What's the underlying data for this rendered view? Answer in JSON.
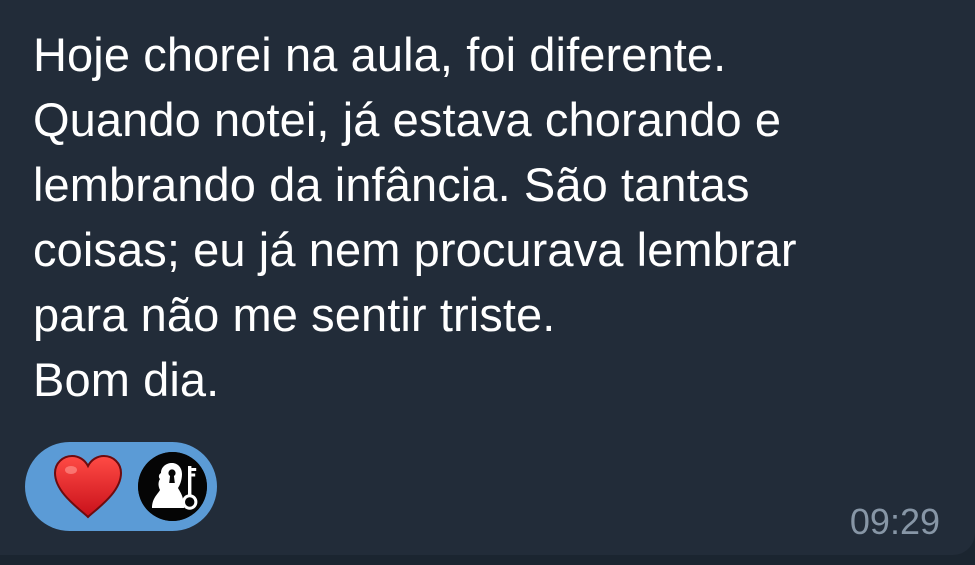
{
  "message": {
    "text": "Hoje chorei na aula, foi diferente.\nQuando notei, já estava chorando e\nlembrando da infância. São tantas\ncoisas; eu já nem procurava lembrar\npara não me sentir triste.\nBom dia.",
    "timestamp": "09:29"
  },
  "reaction": {
    "emoji_icon": "red-heart-icon",
    "avatar_icon": "profile-silhouette-key-icon",
    "chip_color": "#5b9bd6",
    "heart_color": "#e8201f"
  },
  "colors": {
    "bubble_background": "#222c39",
    "text": "#ffffff",
    "timestamp": "#8796a6"
  }
}
